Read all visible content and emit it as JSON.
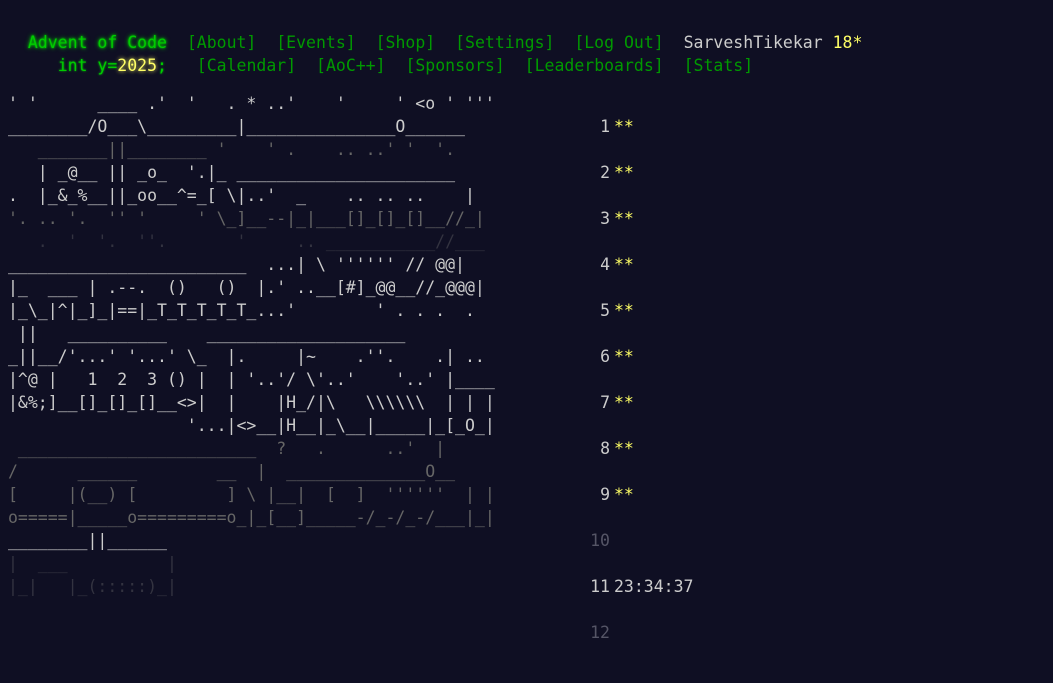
{
  "header": {
    "title": "Advent of Code",
    "year_prefix": "int y=",
    "year": "2025",
    "year_suffix": ";",
    "nav_row1": [
      "[About]",
      "[Events]",
      "[Shop]",
      "[Settings]",
      "[Log Out]"
    ],
    "nav_row2": [
      "[Calendar]",
      "[AoC++]",
      "[Sponsors]",
      "[Leaderboards]",
      "[Stats]"
    ],
    "user": "SarveshTikekar",
    "star_count": "18*"
  },
  "art_lines": [
    "' '      ____ .'  '   . * ..'    '     ' <o ' '''",
    "________/O___\\_________|_______________O______",
    "   _______||________ '    ' .    .. ..' '  '.",
    "   | _@__ || _o_  '.|_ ______________________",
    ".  |_&_%__||_oo__^=_[ \\|..'  _    .. .. ..    |",
    "'. .. '.  '' '     ' \\_]__--|_|___[]_[]_[]__//_|",
    "   .  '  '.  ''.       '     .. ___________//___",
    "________________________  ...| \\ '''''' // @@|",
    "|_  ___ | .--.  ()   ()  |.' ..__[#]_@@__//_@@@|",
    "|_\\_|^|_]_|==|_T_T_T_T_T_...'        ' . . .  .",
    " ||   __________    ____________________",
    "_||__/'...' '...' \\_  |.     |~    .''.    .| ..",
    "|^@ |   1  2  3 () |  | '..'/ \\'..'    '..' |____",
    "|&%;]__[]_[]_[]__<>|  |    |H_/|\\   \\\\\\\\\\\\  | | |",
    "                  '...|<>__|H__|_\\__|_____|_[_O_|",
    " ________________________  ?   .      ..'  |",
    "/      ______        __  |  ______________O__",
    "[     |(__) [         ] \\ |__|  [  ]  ''''''  | |",
    "o=====|_____o=========o_|_[__]_____-/_-/_-/___|_|",
    "________||______",
    "|  ___          |",
    "|_|   |_(:::::)_|"
  ],
  "days": [
    {
      "num": "1",
      "stars": "**"
    },
    {
      "num": "2",
      "stars": "**"
    },
    {
      "num": "3",
      "stars": "**"
    },
    {
      "num": "4",
      "stars": "**"
    },
    {
      "num": "5",
      "stars": "**"
    },
    {
      "num": "6",
      "stars": "**"
    },
    {
      "num": "7",
      "stars": "**"
    },
    {
      "num": "8",
      "stars": "**"
    },
    {
      "num": "9",
      "stars": "**"
    },
    {
      "num": "10",
      "stars": ""
    },
    {
      "num": "11",
      "stars": "",
      "timer": "23:34:37"
    },
    {
      "num": "12",
      "stars": ""
    }
  ],
  "colors": {
    "background": "#0f0f23",
    "title_green": "#00cc00",
    "link_green": "#009900",
    "star_yellow": "#ffff66",
    "text": "#cccccc"
  }
}
